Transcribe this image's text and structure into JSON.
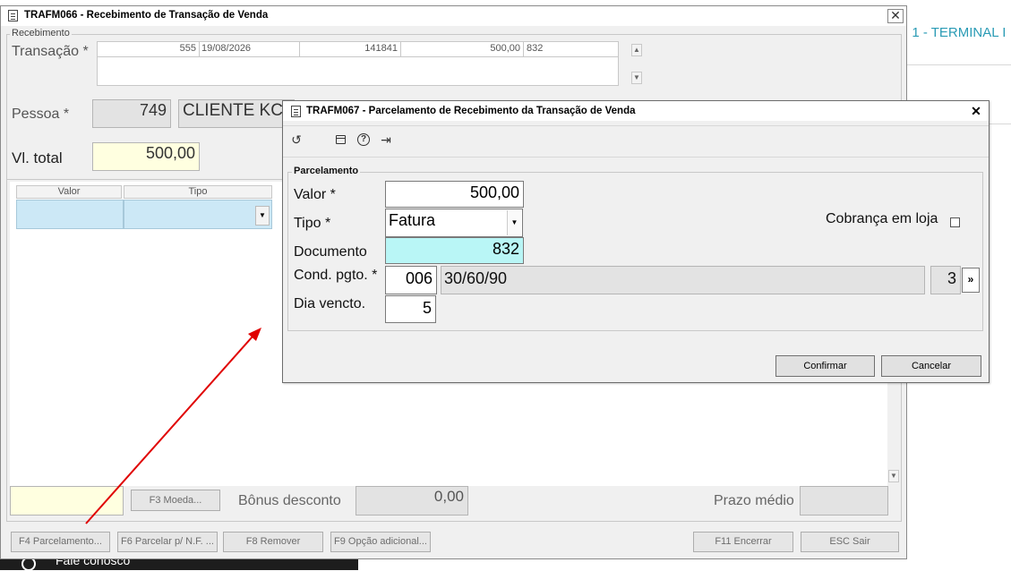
{
  "background": {
    "terminal_text": ": 1 - TERMINAL I",
    "bottom_text": "Fale conosco"
  },
  "main_window": {
    "title": "TRAFM066 - Recebimento de Transação de Venda",
    "group_label": "Recebimento",
    "transacao_label": "Transação *",
    "transacao_cells": [
      "555",
      "19/08/2026",
      "141841",
      "500,00",
      "832"
    ],
    "pessoa_label": "Pessoa *",
    "pessoa_code": "749",
    "pessoa_name": "CLIENTE KC",
    "vltotal_label": "Vl. total",
    "vltotal_value": "500,00",
    "grid_headers": [
      "Valor",
      "Tipo"
    ],
    "f3_button": "F3 Moeda...",
    "bonus_label": "Bônus desconto",
    "bonus_value": "0,00",
    "prazo_label": "Prazo médio",
    "buttons": {
      "f4": "F4 Parcelamento...",
      "f6": "F6 Parcelar p/ N.F. ...",
      "f8": "F8 Remover",
      "f9": "F9 Opção adicional...",
      "f11": "F11 Encerrar",
      "esc": "ESC Sair"
    }
  },
  "dialog": {
    "title": "TRAFM067 - Parcelamento de Recebimento da Transação de Venda",
    "group_label": "Parcelamento",
    "valor_label": "Valor *",
    "valor_value": "500,00",
    "tipo_label": "Tipo *",
    "tipo_value": "Fatura",
    "cobranca_label": "Cobrança em loja",
    "documento_label": "Documento",
    "documento_value": "832",
    "cond_label": "Cond. pgto. *",
    "cond_code": "006",
    "cond_desc": "30/60/90",
    "cond_count": "3",
    "dia_label": "Dia vencto.",
    "dia_value": "5",
    "confirm_label": "Confirmar",
    "cancel_label": "Cancelar"
  },
  "colors": {
    "annotation_arrow": "#e00000",
    "highlight_cyan": "#b9f6f6",
    "highlight_yellow": "#ffffe0",
    "link_teal": "#2a9bb5"
  }
}
